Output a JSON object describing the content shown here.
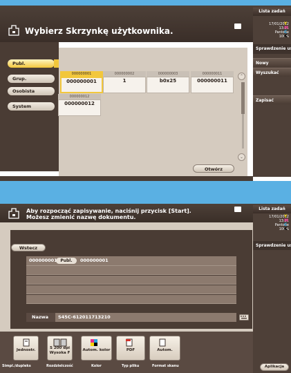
{
  "colors": {
    "accent_yellow": "#f2c73c",
    "header_brown": "#4d4038",
    "panel_beige": "#d5cbbf",
    "top_band_blue": "#5ab0e3"
  },
  "screen1": {
    "top_button": "Lista zadań",
    "title": "Wybierz Skrzynkę użytkownika.",
    "datetime": [
      "17/01/2012",
      "13:21"
    ],
    "toner": {
      "label": "Pantone",
      "percent": "100%",
      "letters": [
        "Y",
        "M",
        "C",
        "K"
      ]
    },
    "right_buttons": [
      {
        "label": "Sprawdzenie ustaw",
        "dim": false
      },
      {
        "label": "Nowy",
        "dim": false
      },
      {
        "label": "Wyszukać",
        "dim": false
      },
      {
        "label": "Zapisać",
        "dim": false
      }
    ],
    "tabs": [
      {
        "label": "Publ.",
        "selected": true
      },
      {
        "label": "Grup.",
        "selected": false
      },
      {
        "label": "Osobista",
        "selected": false
      },
      {
        "label": "System",
        "selected": false
      }
    ],
    "boxes": [
      {
        "tab": "000000001",
        "name": "000000001",
        "selected": true
      },
      {
        "tab": "000000002",
        "name": "1",
        "selected": false
      },
      {
        "tab": "000000003",
        "name": "b0x25",
        "selected": false
      },
      {
        "tab": "000000011",
        "name": "000000011",
        "selected": false
      },
      {
        "tab": "000000012",
        "name": "000000012",
        "selected": false
      }
    ],
    "scroll_up": "⌃",
    "scroll_down": "⌄",
    "open_button": "Otwórz"
  },
  "screen2": {
    "top_button": "Lista zadań",
    "title_line1": "Aby rozpocząć zapisywanie, naciśnij przycisk [Start].",
    "title_line2": "Możesz zmienić nazwę dokumentu.",
    "datetime": [
      "17/01/2012",
      "13:21"
    ],
    "toner": {
      "label": "Pantone",
      "percent": "100%",
      "letters": [
        "Y",
        "M",
        "C",
        "K"
      ]
    },
    "right_button": "Sprawdzenie ustaw",
    "back_button": "Wstecz",
    "path": {
      "box_id": "000000001",
      "tab": "Publ.",
      "box_name": "000000001"
    },
    "name_label": "Nazwa",
    "name_value": "S45C-612011713210",
    "functions": [
      {
        "label": "Jednostr.",
        "caption": "Simpl./dupleks",
        "icon": "single-page-icon"
      },
      {
        "label": "S 200 dpi Wysoka F",
        "caption": "Rozdzielczość",
        "icon": "resolution-icon"
      },
      {
        "label": "Autom. kolor",
        "caption": "Kolor",
        "icon": "color-icon"
      },
      {
        "label": "PDF",
        "caption": "Typ pliku",
        "icon": "pdf-icon"
      },
      {
        "label": "Autom.",
        "caption": "Format skanu",
        "icon": "scan-size-icon"
      }
    ],
    "app_button": "Aplikacja"
  }
}
